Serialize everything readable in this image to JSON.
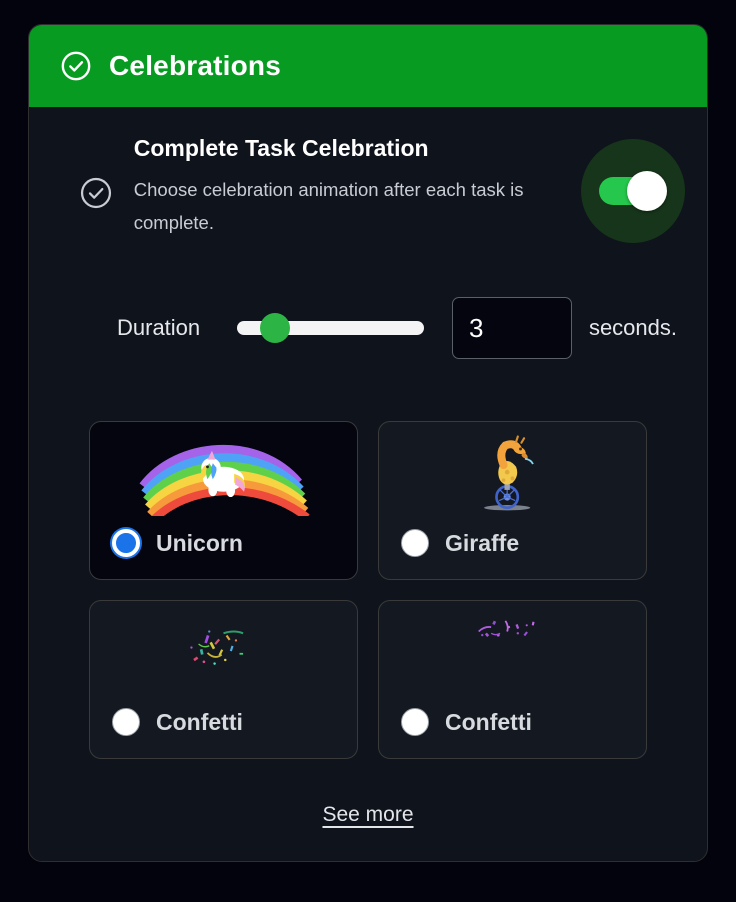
{
  "header": {
    "icon": "check-circle-icon",
    "title": "Celebrations",
    "bg_color": "#079c21"
  },
  "setting": {
    "icon": "check-circle-icon",
    "title": "Complete Task Celebration",
    "description": "Choose celebration animation after each task is complete.",
    "toggle": {
      "state": "on",
      "track_color": "#25c74c",
      "knob_color": "#ffffff",
      "halo_color": "#16351a"
    }
  },
  "duration": {
    "label": "Duration",
    "slider": {
      "value": 3,
      "min": 0,
      "max": 15,
      "percent": 20,
      "track_color": "#f4f4f4",
      "thumb_color": "#2cb544"
    },
    "input_value": "3",
    "input_placeholder": "",
    "unit_label": "seconds."
  },
  "animations": {
    "options": [
      {
        "label": "Unicorn",
        "art": "unicorn-rainbow-art",
        "selected": true
      },
      {
        "label": "Giraffe",
        "art": "giraffe-unicycle-art",
        "selected": false
      },
      {
        "label": "Confetti",
        "art": "confetti-multicolor-art",
        "selected": false
      },
      {
        "label": "Confetti",
        "art": "confetti-purple-art",
        "selected": false
      }
    ],
    "selected_color": "#1a73e8",
    "unselected_color": "#ffffff"
  },
  "footer": {
    "see_more_label": "See more"
  },
  "colors": {
    "page_background": "#03030d",
    "panel_background": "#0f131c",
    "panel_border": "#2e2e2e",
    "accent_green": "#079c21",
    "accent_blue": "#1a73e8"
  }
}
